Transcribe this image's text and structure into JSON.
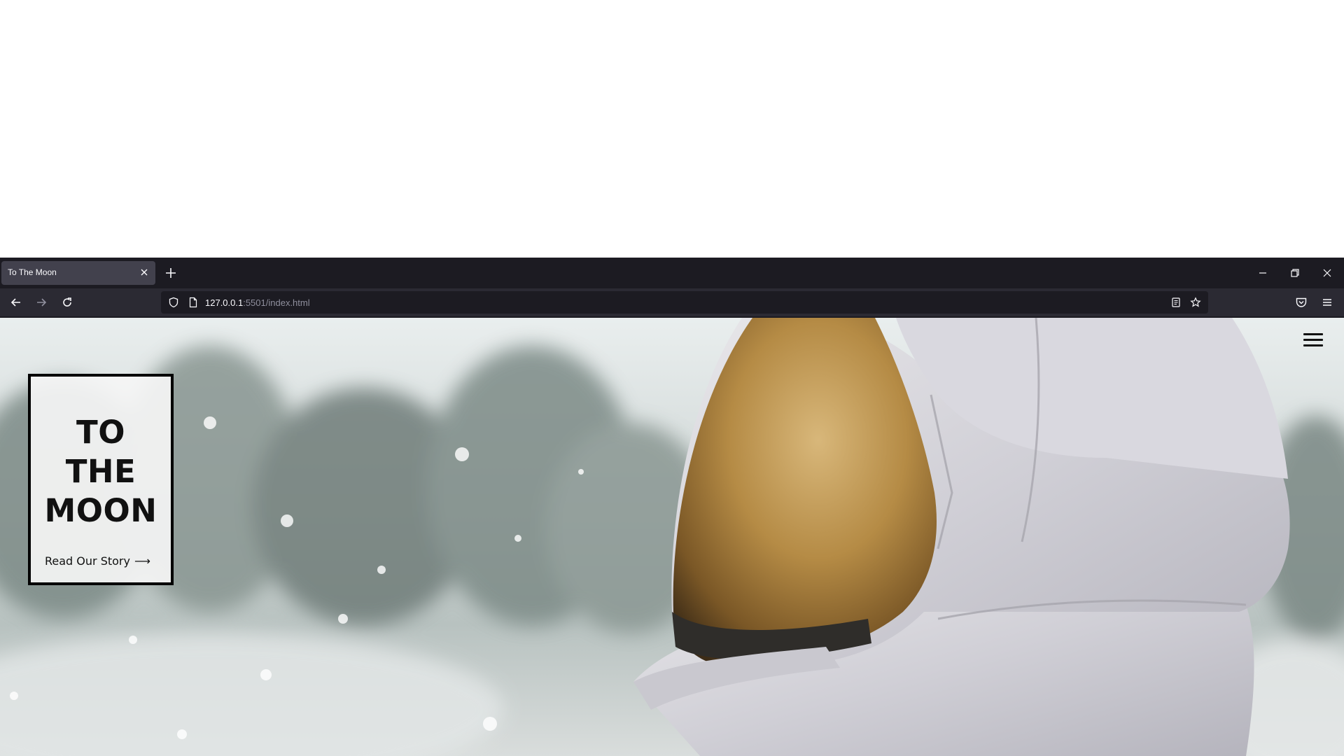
{
  "browser": {
    "tab": {
      "title": "To The Moon",
      "close_icon": "close-icon"
    },
    "new_tab_icon": "plus-icon",
    "window_controls": [
      "minimize-icon",
      "restore-icon",
      "close-icon"
    ],
    "nav": {
      "back_icon": "arrow-left-icon",
      "forward_icon": "arrow-right-icon",
      "reload_icon": "reload-icon"
    },
    "url": {
      "host": "127.0.0.1",
      "rest": ":5501/index.html"
    },
    "url_right_icons": [
      "reader-view-icon",
      "bookmark-star-icon"
    ],
    "toolbar_right_icons": [
      "pocket-icon",
      "app-menu-icon"
    ]
  },
  "page": {
    "hero": {
      "title_lines": [
        "TO",
        "THE",
        "MOON"
      ],
      "link_label": "Read Our Story",
      "link_arrow": "⟶"
    },
    "menu_icon": "hamburger-menu-icon"
  }
}
